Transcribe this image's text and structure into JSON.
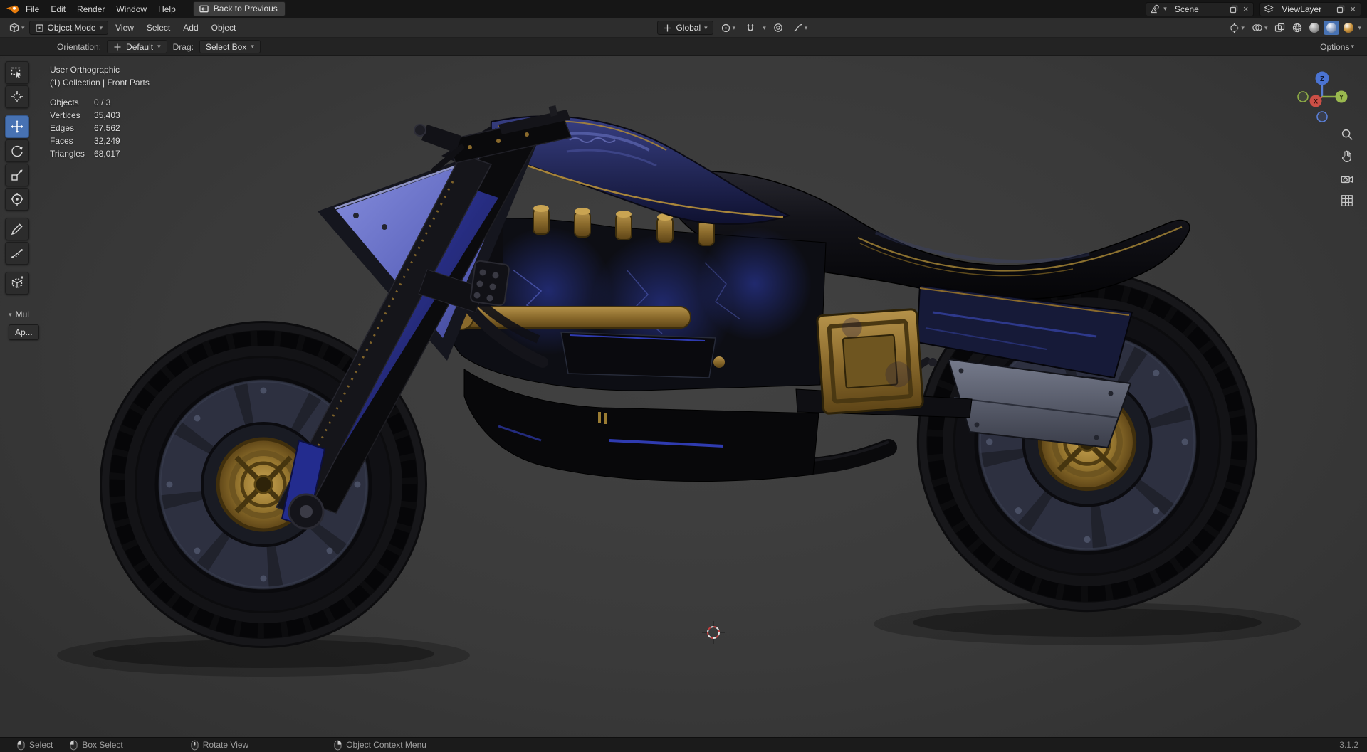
{
  "colors": {
    "accent_blue": "#4772b3",
    "gold": "#b08d3e",
    "viewport_bg": "#3a3a3a",
    "topbar_bg": "#161616",
    "header_bg": "#2d2d2d"
  },
  "icons": {
    "chevron_down": "▾",
    "close": "×"
  },
  "topbar": {
    "menus": [
      "File",
      "Edit",
      "Render",
      "Window",
      "Help"
    ],
    "back_button": "Back to Previous",
    "scene": {
      "label": "Scene"
    },
    "viewlayer": {
      "label": "ViewLayer"
    }
  },
  "header": {
    "mode": "Object Mode",
    "menus": [
      "View",
      "Select",
      "Add",
      "Object"
    ],
    "orientation": "Global"
  },
  "tool_settings": {
    "orientation_label": "Orientation:",
    "orientation_value": "Default",
    "drag_label": "Drag:",
    "drag_value": "Select Box",
    "options_label": "Options"
  },
  "viewport": {
    "view_name": "User Orthographic",
    "collection": "(1) Collection | Front Parts",
    "stats": [
      {
        "label": "Objects",
        "value": "0 / 3"
      },
      {
        "label": "Vertices",
        "value": "35,403"
      },
      {
        "label": "Edges",
        "value": "67,562"
      },
      {
        "label": "Faces",
        "value": "32,249"
      },
      {
        "label": "Triangles",
        "value": "68,017"
      }
    ],
    "collapsed_panel_label": "Mul",
    "apply_button_label": "Ap...",
    "gizmo_axes": {
      "x": "X",
      "y": "Y",
      "z": "Z"
    }
  },
  "statusbar": {
    "items": [
      "Select",
      "Box Select",
      "Rotate View",
      "Object Context Menu"
    ],
    "version": "3.1.2"
  }
}
